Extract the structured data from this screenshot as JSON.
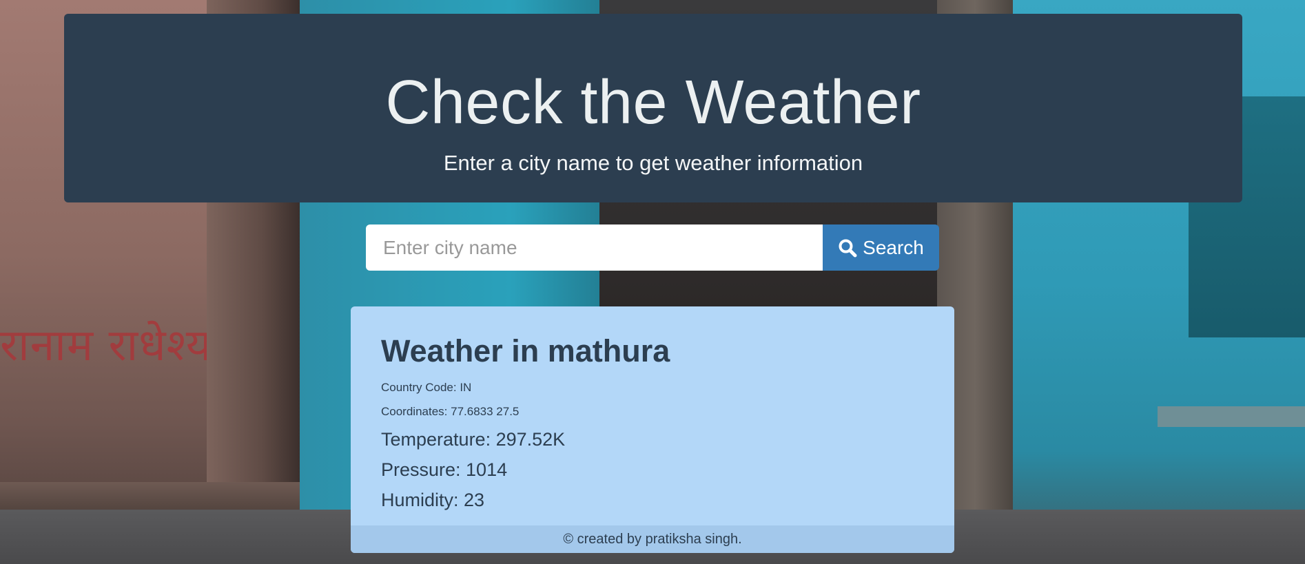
{
  "header": {
    "title": "Check the Weather",
    "subtitle": "Enter a city name to get weather information"
  },
  "search": {
    "placeholder": "Enter city name",
    "value": "",
    "button_label": "Search",
    "button_icon": "search-icon"
  },
  "weather": {
    "title": "Weather in mathura",
    "country_code": "Country Code: IN",
    "coordinates": "Coordinates: 77.6833 27.5",
    "temperature": "Temperature: 297.52K",
    "pressure": "Pressure: 1014",
    "humidity": "Humidity: 23"
  },
  "footer": {
    "text": "© created by pratiksha singh."
  },
  "background": {
    "wall_text": "रानाम राधेश्या"
  },
  "colors": {
    "header_bg": "#2c3e50",
    "button_bg": "#337ab7",
    "card_bg": "#b3d7f8",
    "footer_bg": "#a3c8eb"
  }
}
